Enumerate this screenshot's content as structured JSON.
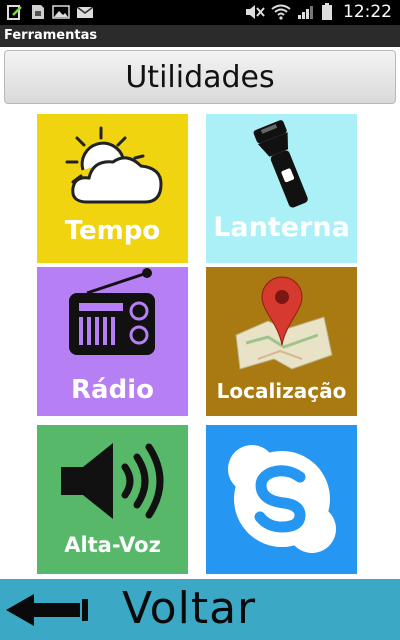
{
  "statusbar": {
    "time": "12:22",
    "left_icons": [
      "edit-icon",
      "sim-icon",
      "image-icon",
      "mail-icon"
    ],
    "right_icons": [
      "mute-icon",
      "wifi-icon",
      "signal-icon",
      "battery-icon"
    ]
  },
  "app": {
    "title": "Ferramentas"
  },
  "header": {
    "label": "Utilidades"
  },
  "tiles": [
    {
      "label": "Tempo",
      "icon": "weather-icon",
      "color": "#f0d40f"
    },
    {
      "label": "Lanterna",
      "icon": "flashlight-icon",
      "color": "#aaf0f6"
    },
    {
      "label": "Rádio",
      "icon": "radio-icon",
      "color": "#b67ff3"
    },
    {
      "label": "Localização",
      "icon": "map-pin-icon",
      "color": "#a97a12"
    },
    {
      "label": "Alta-Voz",
      "icon": "speaker-icon",
      "color": "#58b86a"
    },
    {
      "label": "",
      "icon": "skype-icon",
      "color": "#2596f1"
    }
  ],
  "bottom": {
    "label": "Voltar",
    "icon": "back-arrow-icon",
    "color": "#3ba9c6"
  }
}
